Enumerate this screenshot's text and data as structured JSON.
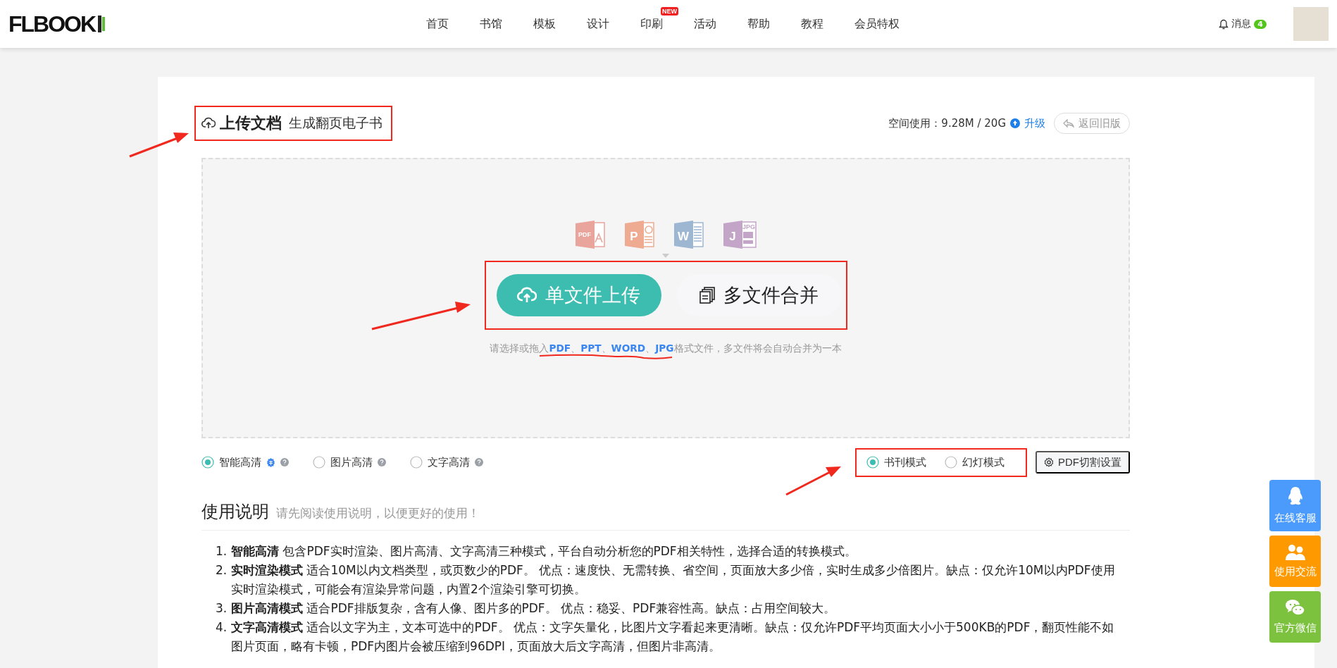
{
  "header": {
    "logo": "FLBOOK",
    "nav": [
      {
        "label": "首页"
      },
      {
        "label": "书馆"
      },
      {
        "label": "模板"
      },
      {
        "label": "设计"
      },
      {
        "label": "印刷",
        "badge": "NEW"
      },
      {
        "label": "活动"
      },
      {
        "label": "帮助"
      },
      {
        "label": "教程"
      },
      {
        "label": "会员特权"
      }
    ],
    "messages": {
      "label": "消息",
      "count": "4"
    }
  },
  "upload": {
    "title": "上传文档",
    "subtitle": "生成翻页电子书",
    "storage": "空间使用：9.28M / 20G",
    "upgrade": "升级",
    "old_version": "返回旧版",
    "file_icons": [
      {
        "kind": "pdf",
        "label": "PDF",
        "color": "#e9a49b"
      },
      {
        "kind": "ppt",
        "label": "P",
        "color": "#efaa92"
      },
      {
        "kind": "word",
        "label": "W",
        "color": "#9db6d2"
      },
      {
        "kind": "jpg",
        "label": "J",
        "sub_label": "JPG",
        "color": "#c3a5c8"
      }
    ],
    "buttons": [
      {
        "label": "单文件上传",
        "kind": "primary"
      },
      {
        "label": "多文件合并",
        "kind": "secondary"
      }
    ],
    "hint": "请选择或拖入**PDF**、**PPT**、**WORD**、**JPG**格式文件，多文件将会自动合并为一本",
    "quality_options": [
      {
        "label": "智能高清",
        "selected": true,
        "recommended": true
      },
      {
        "label": "图片高清",
        "selected": false,
        "recommended": false
      },
      {
        "label": "文字高清",
        "selected": false,
        "recommended": false
      }
    ],
    "mode_options": [
      {
        "label": "书刊模式",
        "selected": true
      },
      {
        "label": "幻灯模式",
        "selected": false
      }
    ],
    "split_settings": "PDF切割设置"
  },
  "instructions": {
    "title": "使用说明",
    "subtitle": "请先阅读使用说明，以便更好的使用！",
    "items": [
      {
        "number": "1.",
        "text": "**智能高清** 包含PDF实时渲染、图片高清、文字高清三种模式，平台自动分析您的PDF相关特性，选择合适的转换模式。"
      },
      {
        "number": "2.",
        "text": "**实时渲染模式** 适合10M以内文档类型，或页数少的PDF。 优点：速度快、无需转换、省空间，页面放大多少倍，实时生成多少倍图片。缺点：仅允许10M以内PDF使用实时渲染模式，可能会有渲染异常问题，内置2个渲染引擎可切换。"
      },
      {
        "number": "3.",
        "text": "**图片高清模式** 适合PDF排版复杂，含有人像、图片多的PDF。 优点：稳妥、PDF兼容性高。缺点：占用空间较大。"
      },
      {
        "number": "4.",
        "text": "**文字高清模式** 适合以文字为主，文本可选中的PDF。 优点：文字矢量化，比图片文字看起来更清晰。缺点：仅允许PDF平均页面大小小于500KB的PDF，翻页性能不如图片页面，略有卡顿，PDF内图片会被压缩到96DPI，页面放大后文字高清，但图片非高清。"
      }
    ]
  },
  "side_tools": [
    {
      "kind": "qq",
      "label": "在线客服",
      "color": "#4b9bfd"
    },
    {
      "kind": "people",
      "label": "使用交流",
      "color": "#ff9900"
    },
    {
      "kind": "chat",
      "label": "官方微信",
      "color": "#7cc23f"
    }
  ]
}
